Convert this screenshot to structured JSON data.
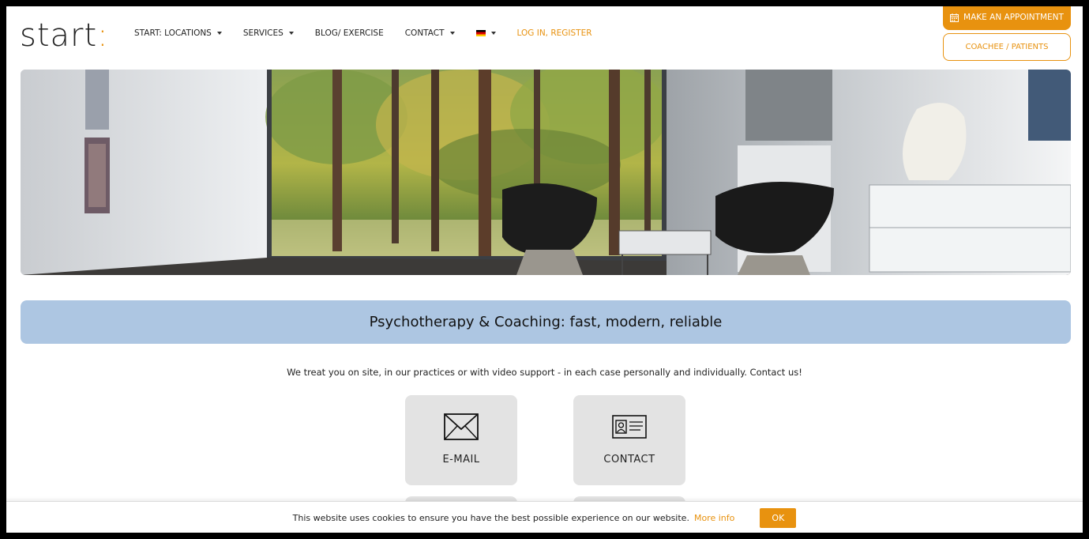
{
  "header": {
    "logo_text": "start",
    "logo_colon": ":",
    "nav": [
      {
        "label": "START: LOCATIONS",
        "has_dropdown": true
      },
      {
        "label": "SERVICES",
        "has_dropdown": true
      },
      {
        "label": "BLOG/ EXERCISE",
        "has_dropdown": false
      },
      {
        "label": "CONTACT",
        "has_dropdown": true
      }
    ],
    "language_icon": "german-flag-icon",
    "login_label": "LOG IN, REGISTER",
    "appointment_label": "MAKE AN APPOINTMENT",
    "appointment_icon": "calendar-icon",
    "coachee_label": "COACHEE / PATIENTS"
  },
  "hero": {
    "image": "therapy-room-forest-window"
  },
  "banner": {
    "title": "Psychotherapy & Coaching: fast, modern, reliable"
  },
  "intro": {
    "text": "We treat you on site, in our practices or with video support - in each case personally and individually. Contact us!"
  },
  "tiles": [
    {
      "label": "E-MAIL",
      "icon": "envelope-icon"
    },
    {
      "label": "CONTACT",
      "icon": "id-card-icon"
    }
  ],
  "cookie": {
    "text": "This website uses cookies to ensure you have the best possible experience on our website.",
    "more_label": "More info",
    "ok_label": "OK"
  },
  "colors": {
    "accent": "#e8920f",
    "banner": "#adc6e2",
    "tile": "#e3e3e3"
  }
}
